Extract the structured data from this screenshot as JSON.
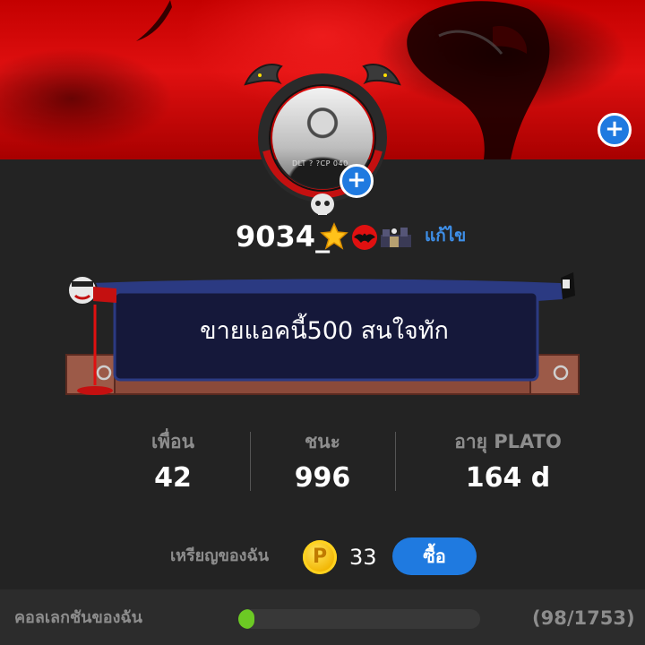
{
  "profile": {
    "username": "9034_",
    "edit_label": "แก้ไข",
    "bio": "ขายแอคนี้500 สนใจทัก",
    "cover_text": "+",
    "avatar_add": "+",
    "avatar_photo_text": "DLT ? ?CP 040"
  },
  "stats": {
    "friends_label": "เพื่อน",
    "friends_value": "42",
    "wins_label": "ชนะ",
    "wins_value": "996",
    "age_label": "อายุ PLATO",
    "age_value": "164 d"
  },
  "coins": {
    "label": "เหรียญของฉัน",
    "symbol": "P",
    "count": "33",
    "buy_label": "ซื้อ"
  },
  "collection": {
    "label": "คอลเลกชันของฉัน",
    "progress_text": "(98/1753)",
    "collected": 98,
    "total": 1753
  },
  "colors": {
    "accent": "#1f7ae0",
    "edit_link": "#3e8fe8",
    "progress": "#6cc924",
    "cover": "#e01010",
    "background": "#232323"
  },
  "icons": {
    "cover_add": "plus-circle-icon",
    "avatar_add": "plus-circle-icon",
    "badge_star": "star-icon",
    "badge_bat": "bat-icon",
    "badge_castle": "castle-icon",
    "skull": "skull-icon",
    "coin": "coin-icon"
  }
}
